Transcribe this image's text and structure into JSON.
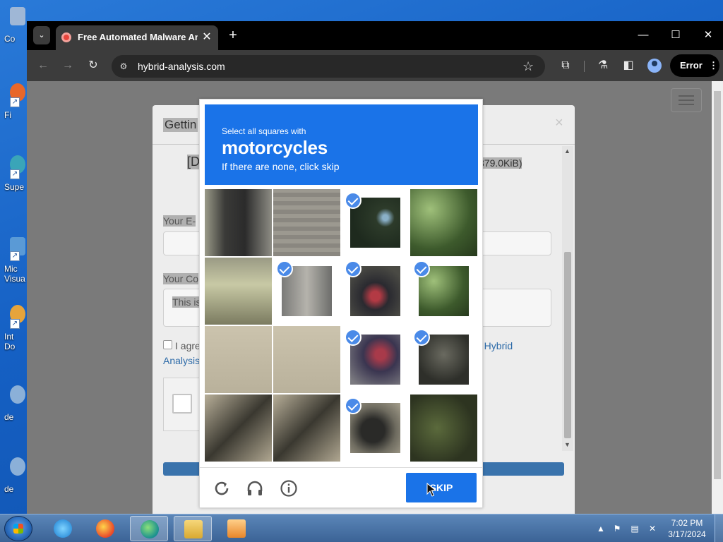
{
  "desktop": {
    "icons": [
      {
        "label": "Co",
        "color": "#9fb7d6"
      },
      {
        "label": "Fi",
        "color": "#e8672a"
      },
      {
        "label": "Supe",
        "color": "#3aa5b8"
      },
      {
        "label": "Mic\nVisua",
        "color": "#5a9ad6"
      },
      {
        "label": "Int\nDo",
        "color": "#e6a43b"
      },
      {
        "label": "de",
        "color": "#8bb0d8"
      },
      {
        "label": "de",
        "color": "#8bb0d8"
      }
    ]
  },
  "browser": {
    "tab_title": "Free Automated Malware Anal",
    "tab_close": "✕",
    "new_tab": "+",
    "url": "hybrid-analysis.com",
    "error_label": "Error",
    "win_minimize": "—",
    "win_maximize": "☐",
    "win_close": "✕"
  },
  "modal": {
    "title": "Gettin",
    "close": "×",
    "file_prefix": "[D",
    "file_size": "379.0KiB)",
    "email_label": "Your E-",
    "comment_label": "Your Co",
    "comment_value": "This is",
    "agree_text": "I agre",
    "agree_link_end": "e Hybrid",
    "agree_link_2": "Analysis"
  },
  "captcha": {
    "line1": "Select all squares with",
    "keyword": "motorcycles",
    "line3": "If there are none, click skip",
    "skip_label": "SKIP",
    "colors": {
      "header": "#1a73e8",
      "tick": "#4a8ae8"
    },
    "tiles": [
      {
        "selected": false,
        "tone": "dark-doorway"
      },
      {
        "selected": false,
        "tone": "wooden-wall"
      },
      {
        "selected": true,
        "tone": "dark-foliage"
      },
      {
        "selected": false,
        "tone": "green-plants"
      },
      {
        "selected": false,
        "tone": "wall-plant"
      },
      {
        "selected": true,
        "tone": "wall-shadow"
      },
      {
        "selected": true,
        "tone": "motorcycle-rear"
      },
      {
        "selected": true,
        "tone": "green-plants"
      },
      {
        "selected": false,
        "tone": "dirt-ground"
      },
      {
        "selected": false,
        "tone": "dirt-ground"
      },
      {
        "selected": true,
        "tone": "motorcycle-body"
      },
      {
        "selected": true,
        "tone": "motorcycle-dark"
      },
      {
        "selected": false,
        "tone": "ground-shadow"
      },
      {
        "selected": false,
        "tone": "ground-shadow"
      },
      {
        "selected": true,
        "tone": "motorcycle-wheel"
      },
      {
        "selected": false,
        "tone": "ground-leaves"
      }
    ]
  },
  "taskbar": {
    "time": "7:02 PM",
    "date": "3/17/2024",
    "items": [
      "ie-icon",
      "firefox-icon",
      "edge-icon",
      "explorer-icon",
      "media-player-icon"
    ]
  }
}
